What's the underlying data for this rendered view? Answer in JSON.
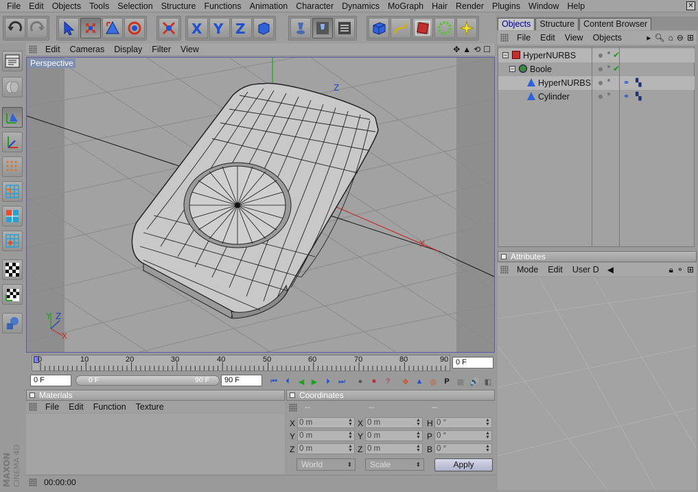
{
  "menubar": [
    "File",
    "Edit",
    "Objects",
    "Tools",
    "Selection",
    "Structure",
    "Functions",
    "Animation",
    "Character",
    "Dynamics",
    "MoGraph",
    "Hair",
    "Render",
    "Plugins",
    "Window",
    "Help"
  ],
  "viewport": {
    "menus": [
      "Edit",
      "Cameras",
      "Display",
      "Filter",
      "View"
    ],
    "label": "Perspective",
    "axes": {
      "x": "X",
      "y": "Y",
      "z": "Z"
    }
  },
  "timeline": {
    "ticks": [
      "0",
      "10",
      "20",
      "30",
      "40",
      "50",
      "60",
      "70",
      "80",
      "90"
    ],
    "current_frame": "0 F"
  },
  "transport": {
    "start_field": "0 F",
    "slider_start": "0 F",
    "slider_end": "90 F",
    "end_field": "90 F"
  },
  "materials": {
    "title": "Materials",
    "menus": [
      "File",
      "Edit",
      "Function",
      "Texture"
    ]
  },
  "coordinates": {
    "title": "Coordinates",
    "col_headers": [
      "--",
      "--",
      "--"
    ],
    "position": [
      {
        "axis": "X",
        "value": "0 m"
      },
      {
        "axis": "Y",
        "value": "0 m"
      },
      {
        "axis": "Z",
        "value": "0 m"
      }
    ],
    "size": [
      {
        "axis": "X",
        "value": "0 m"
      },
      {
        "axis": "Y",
        "value": "0 m"
      },
      {
        "axis": "Z",
        "value": "0 m"
      }
    ],
    "rotation": [
      {
        "axis": "H",
        "value": "0 °"
      },
      {
        "axis": "P",
        "value": "0 °"
      },
      {
        "axis": "B",
        "value": "0 °"
      }
    ],
    "mode1": "World",
    "mode2": "Scale",
    "apply_label": "Apply"
  },
  "right_panel": {
    "tabs": [
      "Objects",
      "Structure",
      "Content Browser"
    ],
    "object_menus": [
      "File",
      "Edit",
      "View",
      "Objects"
    ],
    "objects": [
      {
        "name": "HyperNURBS",
        "depth": 0
      },
      {
        "name": "Boole",
        "depth": 1
      },
      {
        "name": "HyperNURBS",
        "depth": 2
      },
      {
        "name": "Cylinder",
        "depth": 2
      }
    ],
    "attributes_title": "Attributes",
    "attribute_menus": [
      "Mode",
      "Edit",
      "User D"
    ]
  },
  "status": {
    "time": "00:00:00"
  },
  "brand": {
    "line1": "MAXON",
    "line2": "CINEMA 4D"
  },
  "colors": {
    "accent": "#1a4fd0",
    "viewport_border": "#5a5aa8",
    "x_axis": "#c03030",
    "y_axis": "#20a020",
    "z_axis": "#2040c0"
  }
}
